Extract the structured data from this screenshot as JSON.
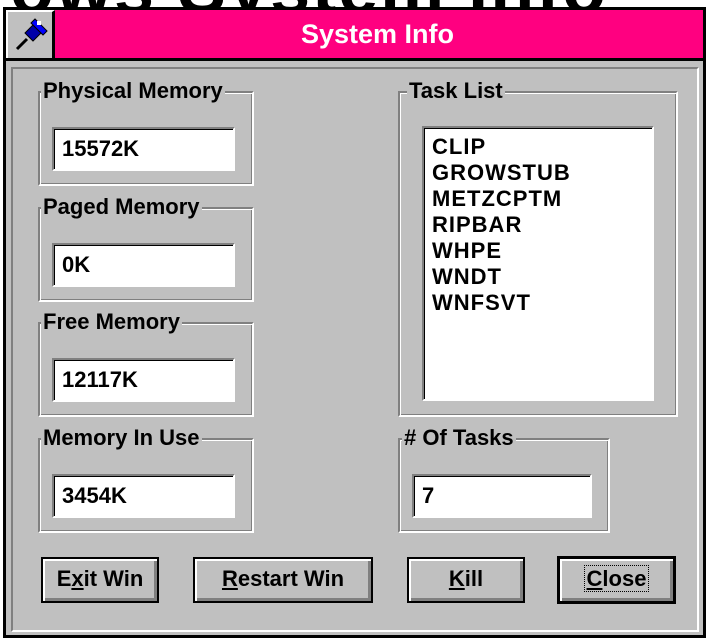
{
  "window": {
    "title": "System Info",
    "background_title": "ows System Info"
  },
  "groups": {
    "physical_memory": {
      "label": "Physical Memory",
      "value": "15572K"
    },
    "paged_memory": {
      "label": "Paged Memory",
      "value": "0K"
    },
    "free_memory": {
      "label": "Free Memory",
      "value": "12117K"
    },
    "memory_in_use": {
      "label": "Memory In Use",
      "value": "3454K"
    },
    "task_list": {
      "label": "Task List",
      "items": [
        "CLIP",
        "GROWSTUB",
        "METZCPTM",
        "RIPBAR",
        "WHPE",
        "WNDT",
        "WNFSVT"
      ]
    },
    "num_tasks": {
      "label": "# Of Tasks",
      "value": "7"
    }
  },
  "buttons": {
    "exit_win": {
      "mnemonic": "x",
      "pre": "E",
      "post": "it Win"
    },
    "restart_win": {
      "mnemonic": "R",
      "pre": "",
      "post": "estart Win"
    },
    "kill": {
      "mnemonic": "K",
      "pre": "",
      "post": "ill"
    },
    "close": {
      "mnemonic": "C",
      "pre": "",
      "post": "lose"
    }
  },
  "colors": {
    "titlebar": "#ff0080",
    "face": "#c0c0c0"
  },
  "icons": {
    "system_menu": "pushpin-icon"
  }
}
